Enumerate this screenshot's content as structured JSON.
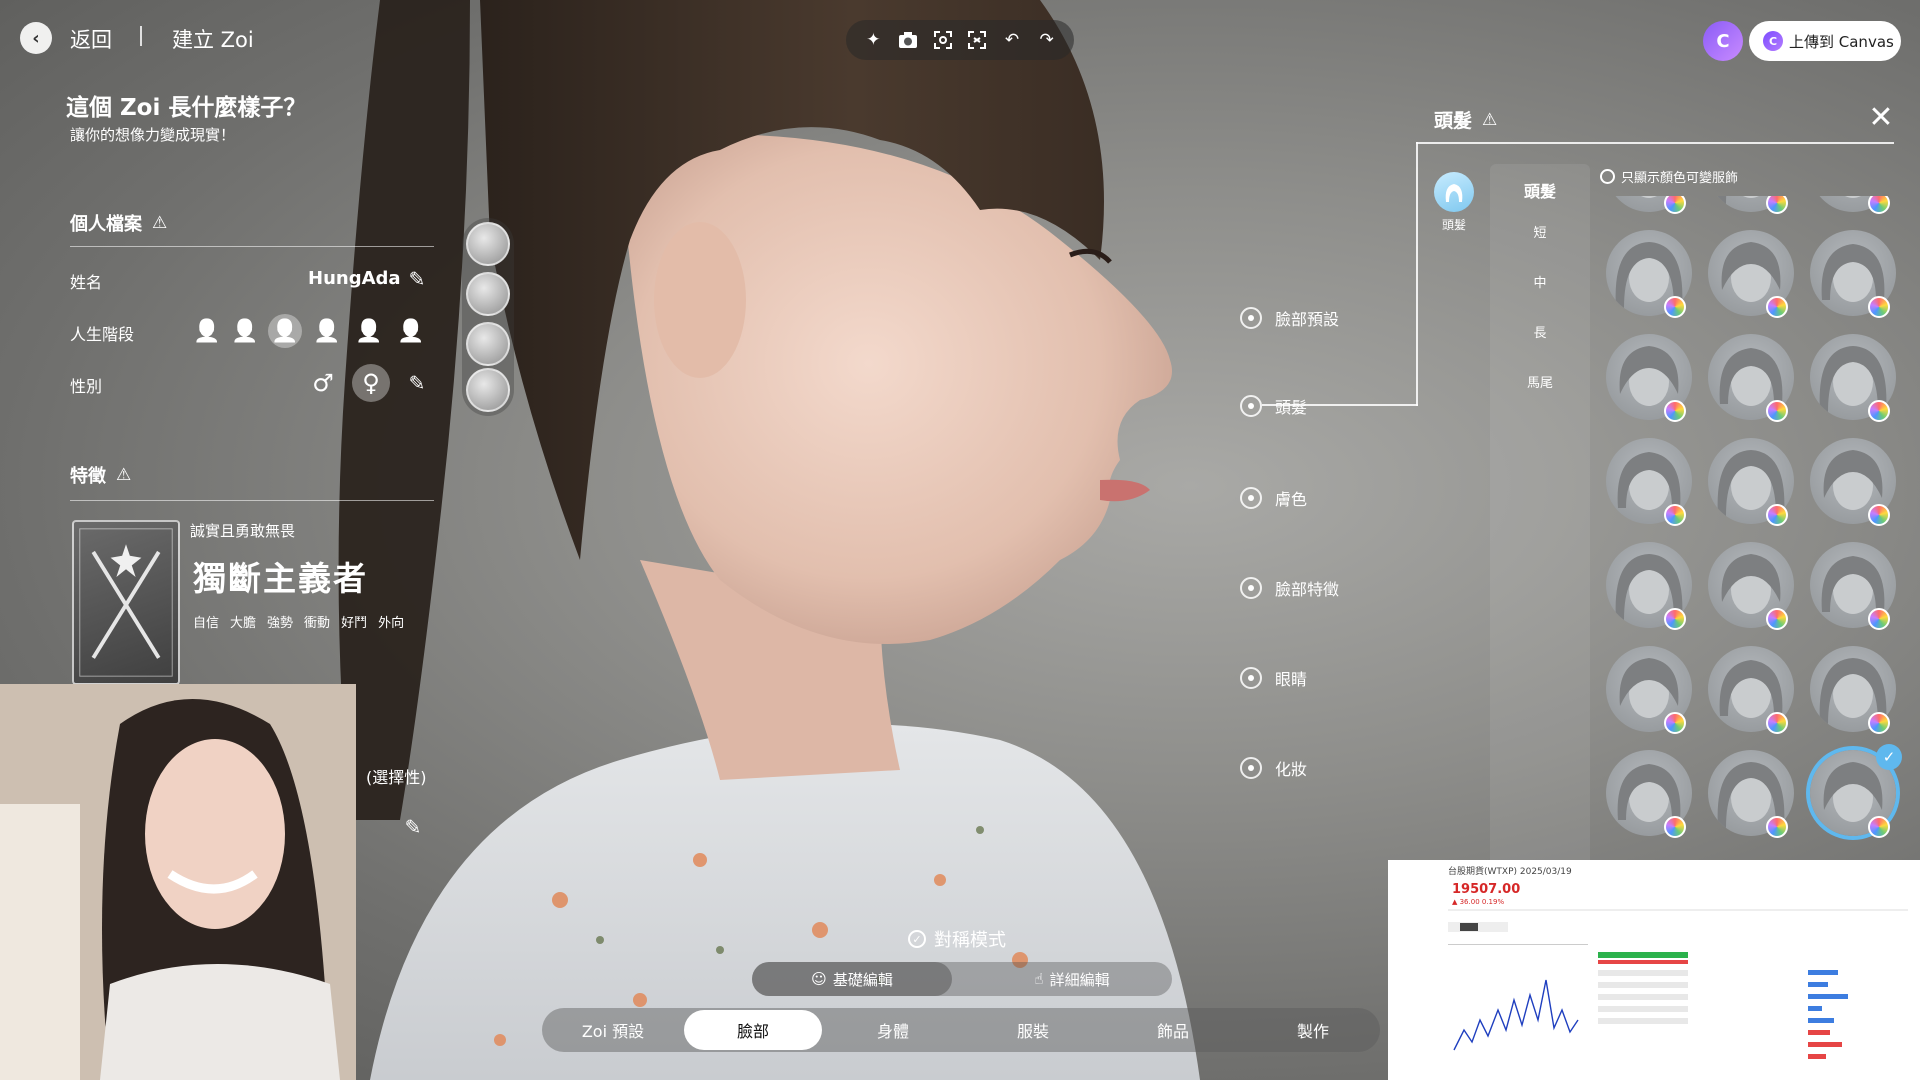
{
  "topbar": {
    "back_label": "返回",
    "page_label": "建立 Zoi",
    "tools": [
      "sparkle-icon",
      "camera-icon",
      "frame-icon",
      "face-frame-icon",
      "undo-icon",
      "redo-icon"
    ],
    "canvas_logo": "C",
    "upload_label": "上傳到 Canvas"
  },
  "left": {
    "title": "這個 Zoi 長什麼樣子？",
    "subtitle": "讓你的想像力變成現實！",
    "profile": {
      "heading": "個人檔案",
      "name_label": "姓名",
      "name_value": "HungAda",
      "life_stage_label": "人生階段",
      "life_stages_count": 6,
      "life_stage_selected": 3,
      "gender_label": "性別",
      "gender_selected": "female",
      "male_symbol": "♂",
      "female_symbol": "♀"
    },
    "traits": {
      "heading": "特徵",
      "tagline": "誠實且勇敢無畏",
      "name": "獨斷主義者",
      "tags": [
        "自信",
        "大膽",
        "強勢",
        "衝動",
        "好鬥",
        "外向"
      ]
    },
    "optional_label": "(選擇性)"
  },
  "categories": [
    "臉部預設",
    "頭髮",
    "膚色",
    "臉部特徵",
    "眼睛",
    "化妝"
  ],
  "categories_selected": "頭髮",
  "hair_panel": {
    "title": "頭髮",
    "category_label": "頭髮",
    "subcategories": [
      "頭髮",
      "短",
      "中",
      "長",
      "馬尾"
    ],
    "filter_label": "只顯示顏色可變服飾",
    "selected_index": 20,
    "items_count": 21
  },
  "bottom": {
    "symmetry_label": "對稱模式",
    "edit_modes": [
      "基礎編輯",
      "詳細編輯"
    ],
    "edit_mode_selected": "基礎編輯",
    "tabs": [
      "Zoi 預設",
      "臉部",
      "身體",
      "服裝",
      "飾品",
      "製作"
    ],
    "tab_selected": "臉部"
  },
  "stock": {
    "title": "台股期貨(WTXP) 2025/03/19",
    "price": "19507.00",
    "change": "▲ 36.00 0.19%"
  },
  "colors": {
    "accent": "#5fb8ee",
    "price_up": "#d62828"
  }
}
